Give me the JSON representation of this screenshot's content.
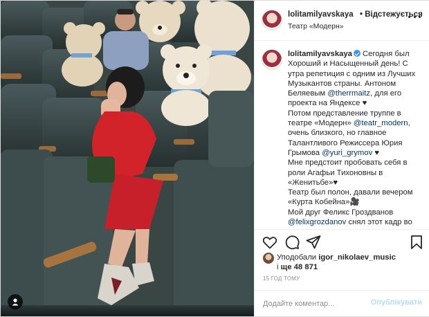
{
  "header": {
    "username": "lolitamilyavskaya",
    "follow_state": "• Відстежується",
    "location": "Театр «Модерн»"
  },
  "caption": {
    "username": "lolitamilyavskaya",
    "lines": [
      "Сегодня был",
      "Хороший и Насыщенный день! С",
      "утра репетиция с одним из Лучших",
      "Музыкантов страны. Антоном",
      "Беляевым",
      "для его",
      "проекта на Яндексе ♥",
      "Потом представление труппе в",
      "театре «Модерн»",
      "очень близкого, но главное",
      "Талантливого Режиссера Юрия",
      "Грымова",
      "♥",
      "Мне предстоит пробовать себя в",
      "роли Агафьи Тихоновны в",
      "«Женитьбе»♥",
      "Театр был полон, давали вечером",
      "«Курта Кобейна»🎥",
      "Мой друг Феликс Гроздванов",
      "снял этот кадр во"
    ],
    "mentions": {
      "therrmaitz": "@therrmaitz,",
      "teatr_modern": "@teatr_modern,",
      "yuri_grymov": "@yuri_grymov",
      "felixgrozdanov": "@felixgrozdanov"
    }
  },
  "likes": {
    "prefix": "Уподобали",
    "user": "igor_nikolaev_music",
    "connector": "і",
    "count_text": "ще 48 871"
  },
  "timestamp": "15 ГОД ТОМУ",
  "comment": {
    "placeholder": "Додайте коментар...",
    "post_label": "Опублікувати"
  },
  "icons": [
    "heart-icon",
    "comment-icon",
    "share-icon",
    "bookmark-icon",
    "more-icon",
    "user-tag-icon",
    "verified-icon"
  ],
  "colors": {
    "mention": "#00376b",
    "verified": "#3897f0",
    "post_disabled": "#b2dffc",
    "muted": "#8e8e8e"
  }
}
